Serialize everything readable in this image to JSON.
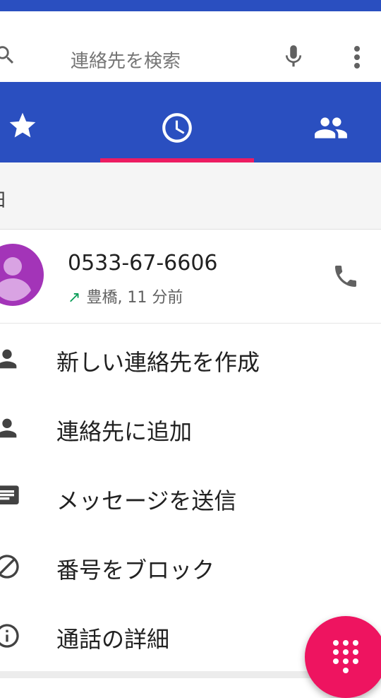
{
  "search": {
    "placeholder": "連絡先を検索"
  },
  "tabs": [
    {
      "icon": "star-icon",
      "label": "お気に入り"
    },
    {
      "icon": "clock-icon",
      "label": "履歴",
      "selected": true
    },
    {
      "icon": "people-icon",
      "label": "連絡先"
    }
  ],
  "section": {
    "label": "日"
  },
  "call": {
    "number": "0533-67-6606",
    "direction_icon": "outgoing-arrow-icon",
    "meta": "豊橋, 11 分前"
  },
  "menu": {
    "items": [
      {
        "label": "新しい連絡先を作成",
        "icon": "person-icon"
      },
      {
        "label": "連絡先に追加",
        "icon": "person-add-icon"
      },
      {
        "label": "メッセージを送信",
        "icon": "message-icon"
      },
      {
        "label": "番号をブロック",
        "icon": "block-icon"
      },
      {
        "label": "通話の詳細",
        "icon": "info-icon"
      }
    ]
  },
  "colors": {
    "primary": "#2a4fc0",
    "accent": "#ec1c62",
    "avatar": "#a334b8",
    "outgoing": "#0a9d58"
  }
}
